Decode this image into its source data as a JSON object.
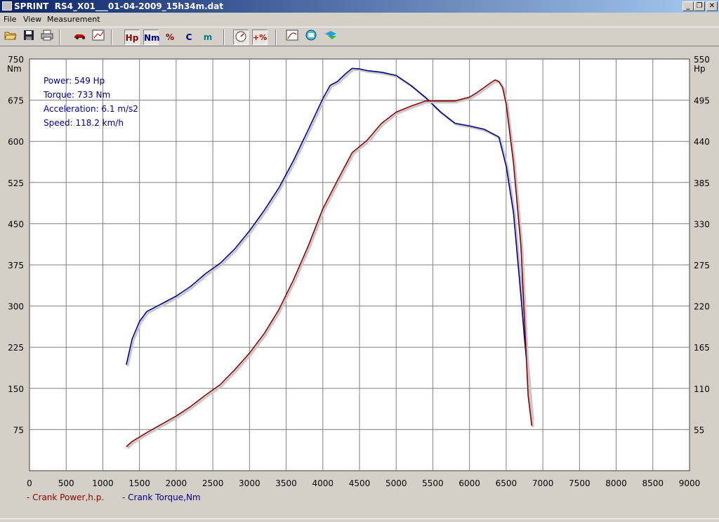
{
  "window": {
    "title": "SPRINT  RS4_X01___01-04-2009_15h34m.dat"
  },
  "window_controls": {
    "minimize": "_",
    "restore": "❐",
    "close": "✕"
  },
  "menu": [
    "File",
    "View",
    "Measurement"
  ],
  "toolbar": {
    "hp": "Hp",
    "nm": "Nm",
    "pct": "%",
    "c": "C",
    "m": "m",
    "plus_pct": "+%"
  },
  "readouts": {
    "power": "Power: 549 Hp",
    "torque": "Torque: 733 Nm",
    "acceleration": "Acceleration: 6.1 m/s2",
    "speed": "Speed: 118.2 km/h"
  },
  "legend": {
    "power": "- Crank Power,h.p.",
    "torque": "- Crank Torque,Nm"
  },
  "colors": {
    "power": "#8b0000",
    "torque": "#00008b",
    "grid": "#808080",
    "plot_bg": "#ffffff"
  },
  "chart_data": {
    "type": "line",
    "xlim": [
      0,
      9000
    ],
    "x_ticks": [
      "0",
      "500",
      "1000",
      "1500",
      "2000",
      "2500",
      "3000",
      "3500",
      "4000",
      "4500",
      "5000",
      "5500",
      "6000",
      "6500",
      "7000",
      "7500",
      "8000",
      "8500",
      "9000"
    ],
    "y_left": {
      "unit": "Nm",
      "min": 0,
      "max": 750,
      "ticks": [
        "750",
        "675",
        "600",
        "525",
        "450",
        "375",
        "300",
        "225",
        "150",
        "75"
      ]
    },
    "y_right": {
      "unit": "Hp",
      "min": 0,
      "max": 550,
      "ticks": [
        "550",
        "495",
        "440",
        "385",
        "330",
        "275",
        "220",
        "165",
        "110",
        "55"
      ]
    },
    "series": [
      {
        "name": "Crank Torque,Nm",
        "axis": "left",
        "x": [
          1320,
          1400,
          1500,
          1600,
          1800,
          2000,
          2200,
          2400,
          2600,
          2800,
          3000,
          3200,
          3400,
          3600,
          3800,
          4000,
          4100,
          4200,
          4300,
          4400,
          4500,
          4600,
          4800,
          5000,
          5200,
          5400,
          5600,
          5800,
          6000,
          6200,
          6400,
          6500,
          6600,
          6700,
          6750,
          6800,
          6830,
          6850
        ],
        "values": [
          193,
          240,
          272,
          290,
          304,
          318,
          336,
          359,
          378,
          404,
          437,
          474,
          515,
          565,
          621,
          678,
          702,
          709,
          722,
          733,
          732,
          729,
          726,
          720,
          702,
          680,
          654,
          633,
          628,
          622,
          608,
          555,
          470,
          320,
          240,
          170,
          120,
          95
        ]
      },
      {
        "name": "Crank Power,h.p.",
        "axis": "right",
        "x": [
          1320,
          1400,
          1500,
          1600,
          1800,
          2000,
          2200,
          2400,
          2600,
          2800,
          3000,
          3200,
          3400,
          3600,
          3800,
          4000,
          4200,
          4400,
          4600,
          4800,
          5000,
          5200,
          5400,
          5600,
          5800,
          6000,
          6100,
          6200,
          6300,
          6350,
          6400,
          6450,
          6500,
          6600,
          6700,
          6750,
          6800,
          6850
        ],
        "values": [
          32,
          39,
          45,
          51,
          62,
          73,
          86,
          101,
          115,
          135,
          157,
          183,
          215,
          255,
          300,
          350,
          388,
          425,
          441,
          464,
          479,
          487,
          494,
          494,
          494,
          499,
          505,
          512,
          519,
          522,
          520,
          512,
          490,
          411,
          301,
          201,
          100,
          60
        ]
      }
    ]
  }
}
